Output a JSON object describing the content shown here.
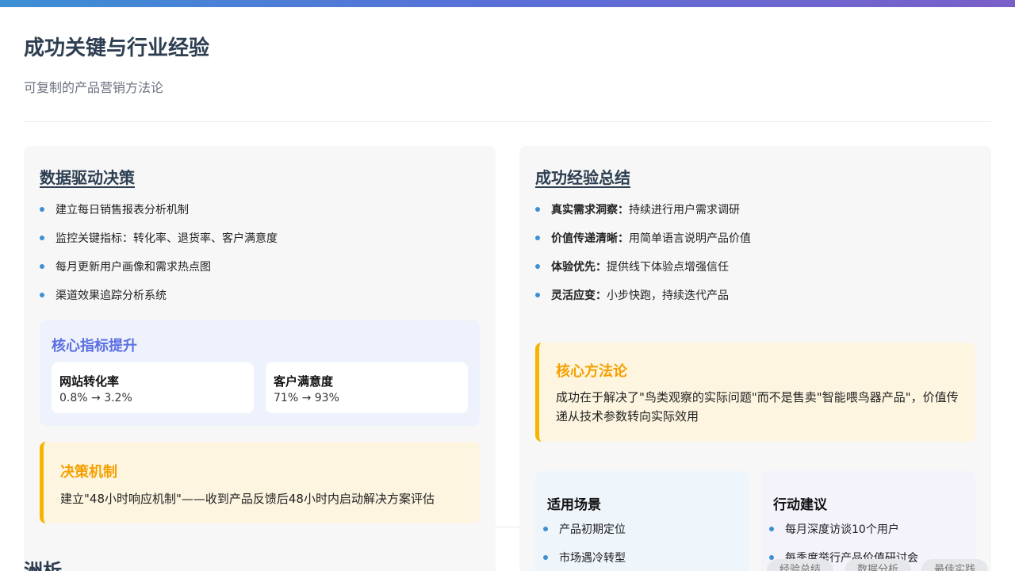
{
  "header": {
    "title": "成功关键与行业经验",
    "subtitle": "可复制的产品营销方法论"
  },
  "left_card": {
    "title": "数据驱动决策",
    "bullets": [
      "建立每日销售报表分析机制",
      "监控关键指标：转化率、退货率、客户满意度",
      "每月更新用户画像和需求热点图",
      "渠道效果追踪分析系统"
    ],
    "metrics": {
      "title": "核心指标提升",
      "items": [
        {
          "label": "网站转化率",
          "value": "0.8% → 3.2%"
        },
        {
          "label": "客户满意度",
          "value": "71% → 93%"
        }
      ]
    },
    "callout": {
      "title": "决策机制",
      "text": "建立\"48小时响应机制\"——收到产品反馈后48小时内启动解决方案评估"
    }
  },
  "right_card": {
    "title": "成功经验总结",
    "bullets": [
      {
        "strong": "真实需求洞察：",
        "text": "持续进行用户需求调研"
      },
      {
        "strong": "价值传递清晰：",
        "text": "用简单语言说明产品价值"
      },
      {
        "strong": "体验优先：",
        "text": "提供线下体验点增强信任"
      },
      {
        "strong": "灵活应变：",
        "text": "小步快跑，持续迭代产品"
      }
    ],
    "callout": {
      "title": "核心方法论",
      "text": "成功在于解决了\"鸟类观察的实际问题\"而不是售卖\"智能喂鸟器产品\"，价值传递从技术参数转向实际效用"
    },
    "scenarios": {
      "title": "适用场景",
      "items": [
        "产品初期定位",
        "市场遇冷转型"
      ]
    },
    "actions": {
      "title": "行动建议",
      "items": [
        "每月深度访谈10个用户",
        "每季度举行产品价值研讨会"
      ]
    }
  },
  "bottom": {
    "cut_heading": "洲析",
    "tags": [
      "经验总结",
      "数据分析",
      "最佳实践"
    ]
  },
  "colors": {
    "accent": "#3d8fd4",
    "metric_title": "#5b6fe0",
    "callout_border": "#f5b400",
    "callout_title": "#f5a000"
  }
}
